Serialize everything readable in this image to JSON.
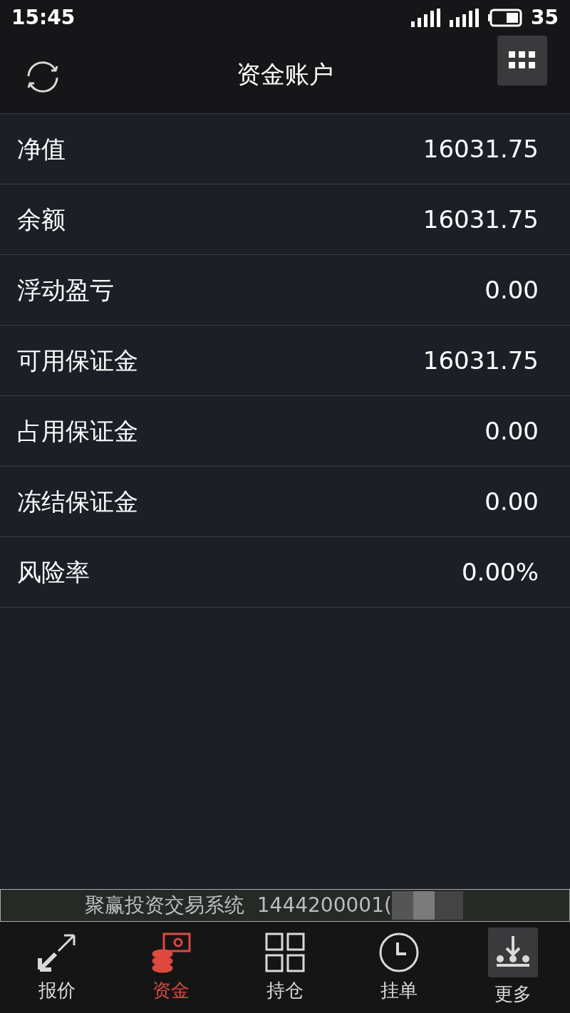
{
  "status_bar": {
    "time": "15:45",
    "battery": "35"
  },
  "header": {
    "title": "资金账户"
  },
  "rows": [
    {
      "label": "净值",
      "value": "16031.75"
    },
    {
      "label": "余额",
      "value": "16031.75"
    },
    {
      "label": "浮动盈亏",
      "value": "0.00"
    },
    {
      "label": "可用保证金",
      "value": "16031.75"
    },
    {
      "label": "占用保证金",
      "value": "0.00"
    },
    {
      "label": "冻结保证金",
      "value": "0.00"
    },
    {
      "label": "风险率",
      "value": "0.00%"
    }
  ],
  "ticker": {
    "text": "聚赢投资交易系统  1444200001("
  },
  "tabs": [
    {
      "label": "报价",
      "kind": "quote",
      "selected": false
    },
    {
      "label": "资金",
      "kind": "funds",
      "selected": true
    },
    {
      "label": "持仓",
      "kind": "positions",
      "selected": false
    },
    {
      "label": "挂单",
      "kind": "orders",
      "selected": false
    },
    {
      "label": "更多",
      "kind": "more",
      "selected": false
    }
  ]
}
